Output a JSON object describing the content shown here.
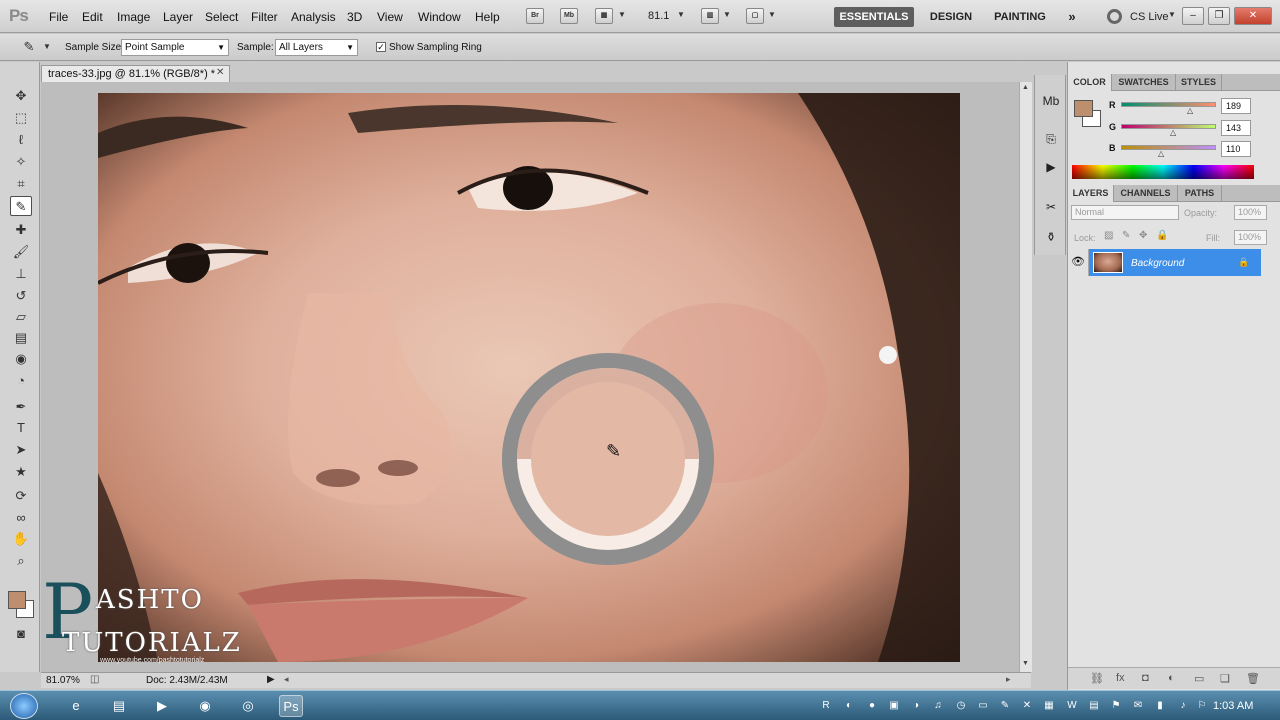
{
  "app": {
    "logo": "Ps"
  },
  "menu": [
    "File",
    "Edit",
    "Image",
    "Layer",
    "Select",
    "Filter",
    "Analysis",
    "3D",
    "View",
    "Window",
    "Help"
  ],
  "appbar": {
    "bridge_label": "Br",
    "minibridge_label": "Mb",
    "zoom": "81.1",
    "workspaces": [
      "ESSENTIALS",
      "DESIGN",
      "PAINTING"
    ],
    "more": "»",
    "cs_live": "CS Live",
    "window_controls": [
      "–",
      "❐",
      "✕"
    ]
  },
  "options": {
    "sample_size_label": "Sample Size:",
    "sample_size_value": "Point Sample",
    "sample_label": "Sample:",
    "sample_value": "All Layers",
    "show_ring_label": "Show Sampling Ring",
    "show_ring_checked": true
  },
  "document": {
    "tab_title": "traces-33.jpg @ 81.1% (RGB/8*) *",
    "close": "✕",
    "zoom_status": "81.07%",
    "doc_status": "Doc: 2.43M/2.43M"
  },
  "watermark": {
    "letter": "P",
    "line1": "ASHTO",
    "line2": "TUTORIALZ",
    "url": "www.youtube.com/pashtotutorialz"
  },
  "panels": {
    "color_tabs": [
      "COLOR",
      "SWATCHES",
      "STYLES"
    ],
    "channels": [
      {
        "label": "R",
        "value": "189"
      },
      {
        "label": "G",
        "value": "143"
      },
      {
        "label": "B",
        "value": "110"
      }
    ],
    "foreground_color": "#bd8f6e",
    "layers_tabs": [
      "LAYERS",
      "CHANNELS",
      "PATHS"
    ],
    "blend_mode": "Normal",
    "opacity_label": "Opacity:",
    "opacity_value": "100%",
    "lock_label": "Lock:",
    "fill_label": "Fill:",
    "fill_value": "100%",
    "layer_name": "Background"
  },
  "taskbar": {
    "clock": "1:03 AM"
  },
  "icons": {
    "tools": [
      "move-icon",
      "marquee-icon",
      "lasso-icon",
      "quick-select-icon",
      "crop-icon",
      "eyedropper-icon",
      "spot-heal-icon",
      "brush-icon",
      "clone-stamp-icon",
      "history-brush-icon",
      "eraser-icon",
      "gradient-icon",
      "blur-icon",
      "dodge-icon",
      "pen-icon",
      "type-icon",
      "path-select-icon",
      "shape-icon",
      "3d-rotate-icon",
      "3d-orbit-icon",
      "hand-icon",
      "zoom-icon"
    ]
  }
}
